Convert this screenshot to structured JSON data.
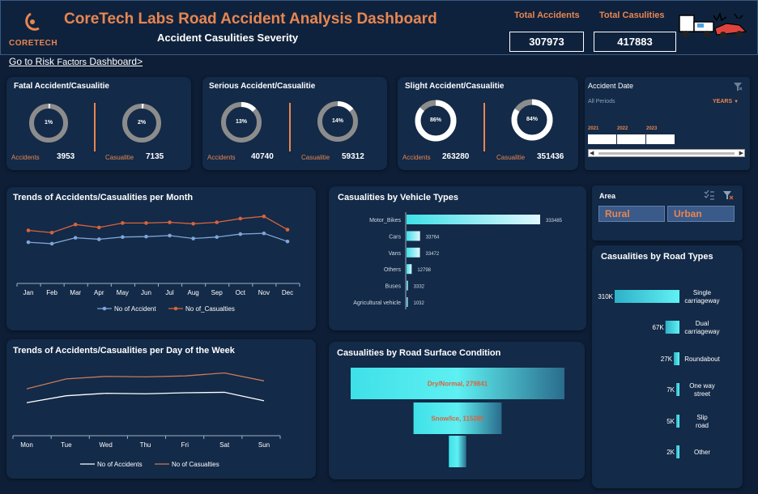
{
  "header": {
    "logo_text": "CORETECH",
    "title": "CoreTech Labs Road Accident Analysis Dashboard",
    "subtitle": "Accident Casulities Severity",
    "total_accidents_label": "Total Accidents",
    "total_accidents_value": "307973",
    "total_casualties_label": "Total Casulities",
    "total_casualties_value": "417883",
    "colors": {
      "accent": "#e88650",
      "background": "#0d1e36",
      "card": "#132a48"
    }
  },
  "nav": {
    "link_main": "Go to Risk ",
    "link_small": "Factors",
    "link_end": " Dashboard>"
  },
  "severity": [
    {
      "title": "Fatal Accident/Casualitie",
      "acc_label": "Accidents",
      "acc_value": "3953",
      "acc_pct_text": "1%",
      "acc_pct": 0.013,
      "cas_label": "Casualitie",
      "cas_value": "7135",
      "cas_pct_text": "2%",
      "cas_pct": 0.017
    },
    {
      "title": "Serious Accident/Casualitie",
      "acc_label": "Accidents",
      "acc_value": "40740",
      "acc_pct_text": "13%",
      "acc_pct": 0.13,
      "cas_label": "Casualitie",
      "cas_value": "59312",
      "cas_pct_text": "14%",
      "cas_pct": 0.14
    },
    {
      "title": "Slight Accident/Casualitie",
      "acc_label": "Accidents",
      "acc_value": "263280",
      "acc_pct_text": "86%",
      "acc_pct": 0.86,
      "cas_label": "Casualitie",
      "cas_value": "351436",
      "cas_pct_text": "84%",
      "cas_pct": 0.84
    }
  ],
  "date_filter": {
    "title": "Accident Date",
    "periods": "All Periods",
    "level": "YEARS",
    "years": [
      "2021",
      "2022",
      "2023"
    ]
  },
  "area_filter": {
    "title": "Area",
    "options": [
      "Rural",
      "Urban"
    ]
  },
  "chart_data": [
    {
      "type": "line",
      "title": "Trends of Accidents/Casualities per Month",
      "categories": [
        "Jan",
        "Feb",
        "Mar",
        "Apr",
        "May",
        "Jun",
        "Jul",
        "Aug",
        "Sep",
        "Oct",
        "Nov",
        "Dec"
      ],
      "series": [
        {
          "name": "No of Accident",
          "color": "#7fa6d9",
          "values": [
            23000,
            22000,
            26000,
            25000,
            26500,
            26800,
            27500,
            25500,
            26500,
            28500,
            29000,
            23500
          ]
        },
        {
          "name": "No of_Casualties",
          "color": "#d9633c",
          "values": [
            31000,
            29500,
            35000,
            33000,
            36000,
            36000,
            36500,
            35500,
            36500,
            39000,
            40500,
            31500
          ]
        }
      ],
      "ylim": [
        0,
        45000
      ]
    },
    {
      "type": "line",
      "title": "Trends of Accidents/Casualities per Day of the Week",
      "categories": [
        "Mon",
        "Tue",
        "Wed",
        "Thu",
        "Fri",
        "Sat",
        "Sun"
      ],
      "series": [
        {
          "name": "No of Accidents",
          "color": "#ffffff",
          "values": [
            34000,
            41000,
            43500,
            43000,
            44000,
            44500,
            36000
          ]
        },
        {
          "name": "No of Casualties",
          "color": "#c97a57",
          "values": [
            48000,
            58000,
            60500,
            60000,
            61000,
            64000,
            56000
          ]
        }
      ],
      "ylim": [
        0,
        75000
      ]
    },
    {
      "type": "bar",
      "title": "Casualities by Vehicle Types",
      "categories": [
        "Motor_Bikes",
        "Cars",
        "Vans",
        "Others",
        "Buses",
        "Agricultural vehicle"
      ],
      "values": [
        333485,
        33764,
        33472,
        12798,
        3332,
        1032
      ]
    },
    {
      "type": "bar",
      "title": "Casualities by Road Surface Condition",
      "categories": [
        "Dry/Normal",
        "Snow/Ice",
        "Other"
      ],
      "values": [
        279841,
        115285,
        22757
      ],
      "data_labels": [
        "Dry/Normal, 279841",
        "Snow/Ice, 115285",
        ""
      ]
    },
    {
      "type": "bar",
      "title": "Casualities by Road Types",
      "categories": [
        "Single carriageway",
        "Dual carriageway",
        "Roundabout",
        "One way street",
        "Slip road",
        "Other"
      ],
      "values": [
        310000,
        67000,
        27000,
        7000,
        5000,
        2000
      ],
      "data_labels": [
        "310K",
        "67K",
        "27K",
        "7K",
        "5K",
        "2K"
      ]
    }
  ]
}
